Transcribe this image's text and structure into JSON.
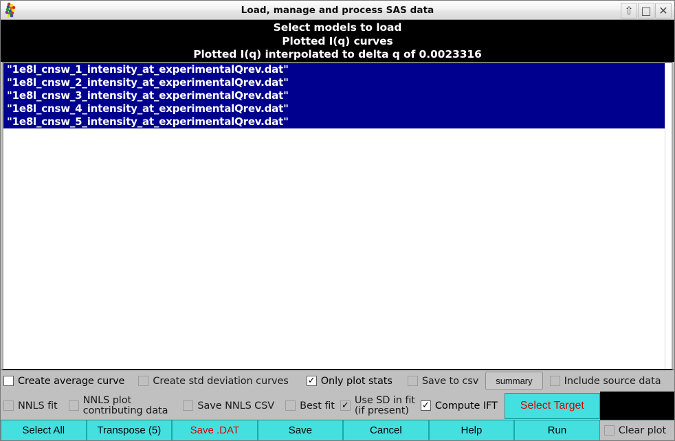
{
  "window": {
    "title": "Load, manage and process SAS data",
    "icon": "molecule-cluster-icon",
    "controls": {
      "minimize": "⇧",
      "maximize": "□",
      "close": "✕"
    }
  },
  "header": {
    "line1": "Select models to load",
    "line2": "Plotted I(q) curves",
    "line3": "Plotted I(q) interpolated to delta q of 0.0023316"
  },
  "file_list": {
    "items": [
      {
        "label": "\"1e8l_cnsw_1_intensity_at_experimentalQrev.dat\"",
        "selected": true
      },
      {
        "label": "\"1e8l_cnsw_2_intensity_at_experimentalQrev.dat\"",
        "selected": true
      },
      {
        "label": "\"1e8l_cnsw_3_intensity_at_experimentalQrev.dat\"",
        "selected": true
      },
      {
        "label": "\"1e8l_cnsw_4_intensity_at_experimentalQrev.dat\"",
        "selected": true
      },
      {
        "label": "\"1e8l_cnsw_5_intensity_at_experimentalQrev.dat\"",
        "selected": true
      }
    ]
  },
  "options_row1": {
    "create_average_curve": {
      "label": "Create average curve",
      "checked": false,
      "enabled": true,
      "mark": ""
    },
    "create_std_deviation": {
      "label": "Create std deviation curves",
      "checked": false,
      "enabled": false,
      "mark": ""
    },
    "only_plot_stats": {
      "label": "Only plot stats",
      "checked": true,
      "enabled": true,
      "mark": "✓"
    },
    "save_to_csv": {
      "label": "Save to csv",
      "checked": false,
      "enabled": false,
      "mark": ""
    },
    "summary_button": "summary",
    "include_source_data": {
      "label": "Include source data",
      "checked": false,
      "enabled": false,
      "mark": ""
    }
  },
  "options_row2": {
    "nnls_fit": {
      "label": "NNLS fit",
      "checked": false,
      "enabled": false,
      "mark": ""
    },
    "nnls_plot_contributing": {
      "label_line1": "NNLS plot",
      "label_line2": "contributing data",
      "checked": false,
      "enabled": false,
      "mark": ""
    },
    "save_nnls_csv": {
      "label": "Save NNLS CSV",
      "checked": false,
      "enabled": false,
      "mark": ""
    },
    "best_fit": {
      "label": "Best fit",
      "checked": false,
      "enabled": false,
      "mark": ""
    },
    "use_sd_in_fit": {
      "label_line1": "Use SD in fit",
      "label_line2": "(if present)",
      "checked": true,
      "enabled": false,
      "mark": "✓"
    },
    "compute_ift": {
      "label": "Compute IFT",
      "checked": true,
      "enabled": true,
      "mark": "✓"
    },
    "select_target_button": "Select Target"
  },
  "buttons": {
    "select_all": "Select All",
    "transpose": "Transpose (5)",
    "save_dat": "Save .DAT",
    "save": "Save",
    "cancel": "Cancel",
    "help": "Help",
    "run": "Run",
    "clear_plot": {
      "label": "Clear plot",
      "checked": false,
      "enabled": false,
      "mark": ""
    }
  },
  "colors": {
    "header_bg": "#000000",
    "selection_blue": "#00008f",
    "button_cyan": "#44e0e0",
    "accent_red": "#dd0000",
    "panel_grey": "#c0c0c0"
  }
}
